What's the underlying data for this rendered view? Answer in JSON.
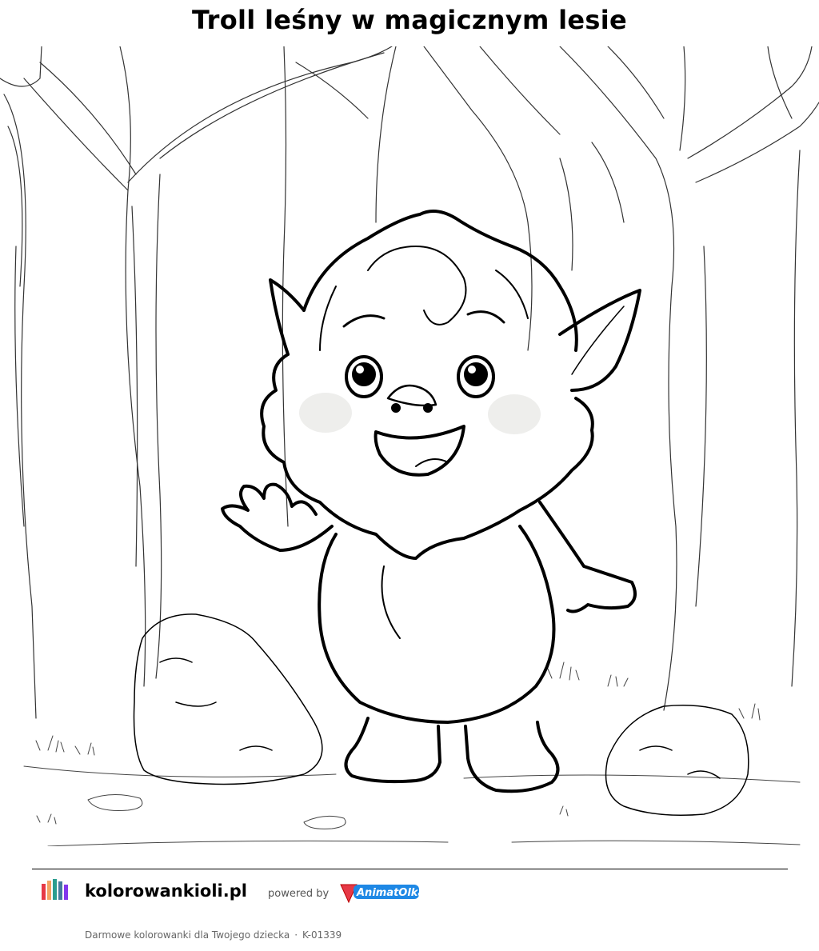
{
  "page": {
    "title": "Troll leśny w magicznym lesie"
  },
  "illustration": {
    "subject": "forest-troll-coloring-illustration"
  },
  "footer": {
    "logo_icon": "kolorowankioli-logo-icon",
    "logo_text": "KolorowankiOli",
    "site_name": "kolorowankioli.pl",
    "powered_by": "powered by",
    "brand_logo_icon": "animatolka-logo-icon",
    "brand_name": "AnimatOlka",
    "tagline": "Darmowe kolorowanki dla Twojego dziecka",
    "separator": "·",
    "code": "K-01339"
  }
}
